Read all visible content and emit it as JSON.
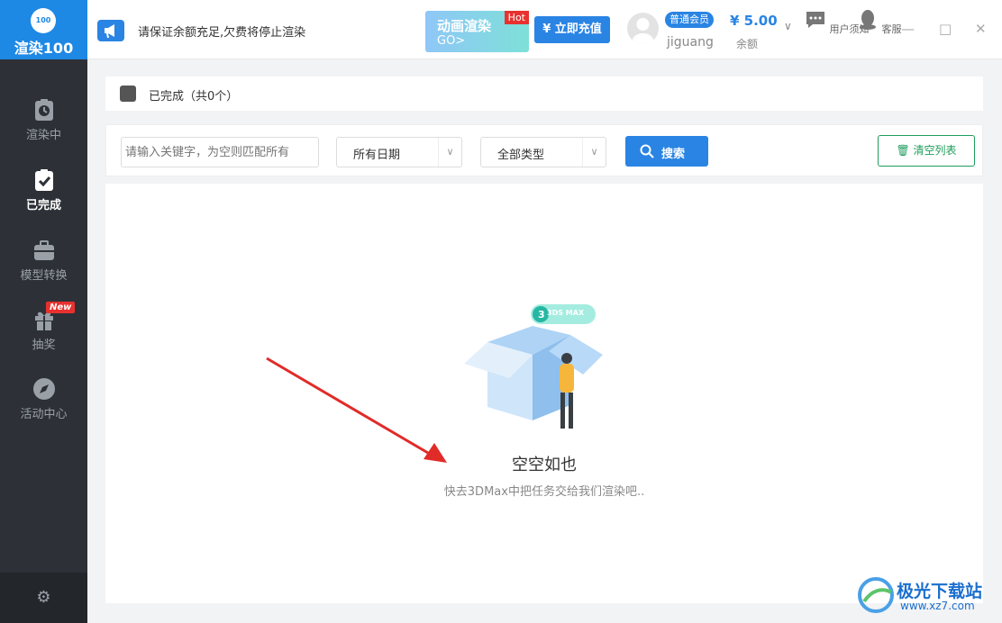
{
  "app": {
    "logo_badge": "100",
    "logo_text": "渲染100"
  },
  "sidebar": {
    "items": [
      {
        "label": "渲染中",
        "icon": "clock-board-icon"
      },
      {
        "label": "已完成",
        "icon": "check-board-icon"
      },
      {
        "label": "模型转换",
        "icon": "briefcase-icon"
      },
      {
        "label": "抽奖",
        "icon": "gift-icon",
        "badge": "New"
      },
      {
        "label": "活动中心",
        "icon": "compass-icon"
      }
    ],
    "settings_icon": "gear-icon"
  },
  "topbar": {
    "notice": "请保证余额充足,欠费将停止渲染",
    "banner_title": "动画渲染",
    "banner_sub": "GO>",
    "banner_badge": "Hot",
    "recharge": "¥ 立即充值",
    "member": "普通会员",
    "username": "jiguang",
    "balance": "¥ 5.00",
    "balance_label": "余额",
    "notices_label": "用户须知",
    "service_label": "客服"
  },
  "filter": {
    "section_title": "已完成（共0个）",
    "keyword_placeholder": "请输入关键字，为空则匹配所有",
    "date_value": "所有日期",
    "type_value": "全部类型",
    "search_label": "搜索",
    "clear_label": "清空列表"
  },
  "empty": {
    "badge": "3DS MAX",
    "title": "空空如也",
    "subtitle": "快去3DMax中把任务交给我们渲染吧.."
  },
  "watermark": {
    "brand": "极光下载站",
    "url": "www.xz7.com"
  },
  "colors": {
    "accent": "#2a84e3",
    "sidebar": "#2d3137",
    "danger": "#e8312f",
    "success": "#1e9d5c"
  }
}
